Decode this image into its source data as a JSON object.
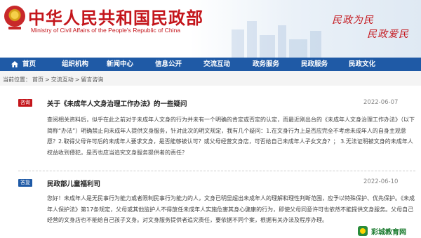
{
  "header": {
    "title": "中华人民共和国民政部",
    "subtitle": "Ministry of Civil Affairs of the People's Republic of China",
    "slogan_line1": "民政为民",
    "slogan_line2": "民政爱民"
  },
  "nav": {
    "items": [
      {
        "label": "首页",
        "icon": "home-icon"
      },
      {
        "label": "组织机构"
      },
      {
        "label": "新闻中心"
      },
      {
        "label": "信息公开"
      },
      {
        "label": "交流互动"
      },
      {
        "label": "政务服务"
      },
      {
        "label": "民政服务"
      },
      {
        "label": "民政文化"
      }
    ]
  },
  "breadcrumb": {
    "label": "当前位置：",
    "items": [
      "首页",
      "交流互动",
      "留言咨询"
    ],
    "separator": ">"
  },
  "question": {
    "badge": "咨询",
    "title": "关于《未成年人文身治理工作办法》的一些疑问",
    "date": "2022-06-07",
    "body": "查阅相关资料后，似乎在此之前对于未成年人文身的行为并未有一个明确的肯定或否定的认定，而最近刚出台的《未成年人文身治理工作办法》（以下简称“办法”）明确禁止向未成年人提供文身服务，针对此次的明文规定，我有几个疑问：1.在文身行为上是否应完全不考虑未成年人的自身主观意愿？2.取得父母许可后的未成年人要求文身，是否能够被认可？或父母经营文身店，可否给自己未成年人子女文身？； 3.无法证明被文身的未成年人权益收到侵犯，是否也应当追究文身服务提供者的责任？"
  },
  "answer": {
    "badge": "答复",
    "title": "民政部儿童福利司",
    "date": "2022-06-10",
    "body": "您好！未成年人是无民事行为能力或者限制民事行为能力的人，文身已明显超出未成年人的理解和理性判断范围，应予以特殊保护、优先保护。《未成年人保护法》第17条规定，父母或其他监护人不得放任未成年人实施危害其身心健康的行为，即使父母同意许可也依然不能提供文身服务。父母自己经营的文身店也不能给自己孩子文身。对文身服务提供者追究责任，要依据不同个案，根据有关办法及程序办理。"
  },
  "watermark": {
    "text": "彩城教育网"
  }
}
